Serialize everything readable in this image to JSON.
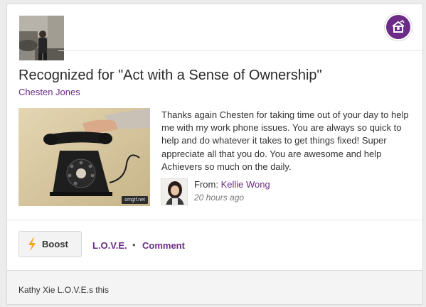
{
  "post": {
    "title": "Recognized for \"Act with a Sense of Ownership\"",
    "recipient": "Chesten Jones",
    "message": "Thanks again Chesten for taking time out of your day to help me with my work phone issues. You are always so quick to help and do whatever it takes to get things fixed! Super appreciate all that you do. You are awesome and help Achievers so much on the daily.",
    "image_watermark": "omgif.net",
    "from_label": "From:",
    "from_name": "Kellie Wong",
    "timestamp": "20 hours ago"
  },
  "actions": {
    "boost_label": "Boost",
    "love_label": "L.O.V.E.",
    "separator": "•",
    "comment_label": "Comment"
  },
  "footer": {
    "love_text": "Kathy Xie L.O.V.E.s this"
  },
  "icons": {
    "badge": "recognition-badge-icon",
    "boost": "lightning-bolt-icon"
  },
  "colors": {
    "accent": "#6b2b86",
    "bolt": "#f5a623"
  }
}
